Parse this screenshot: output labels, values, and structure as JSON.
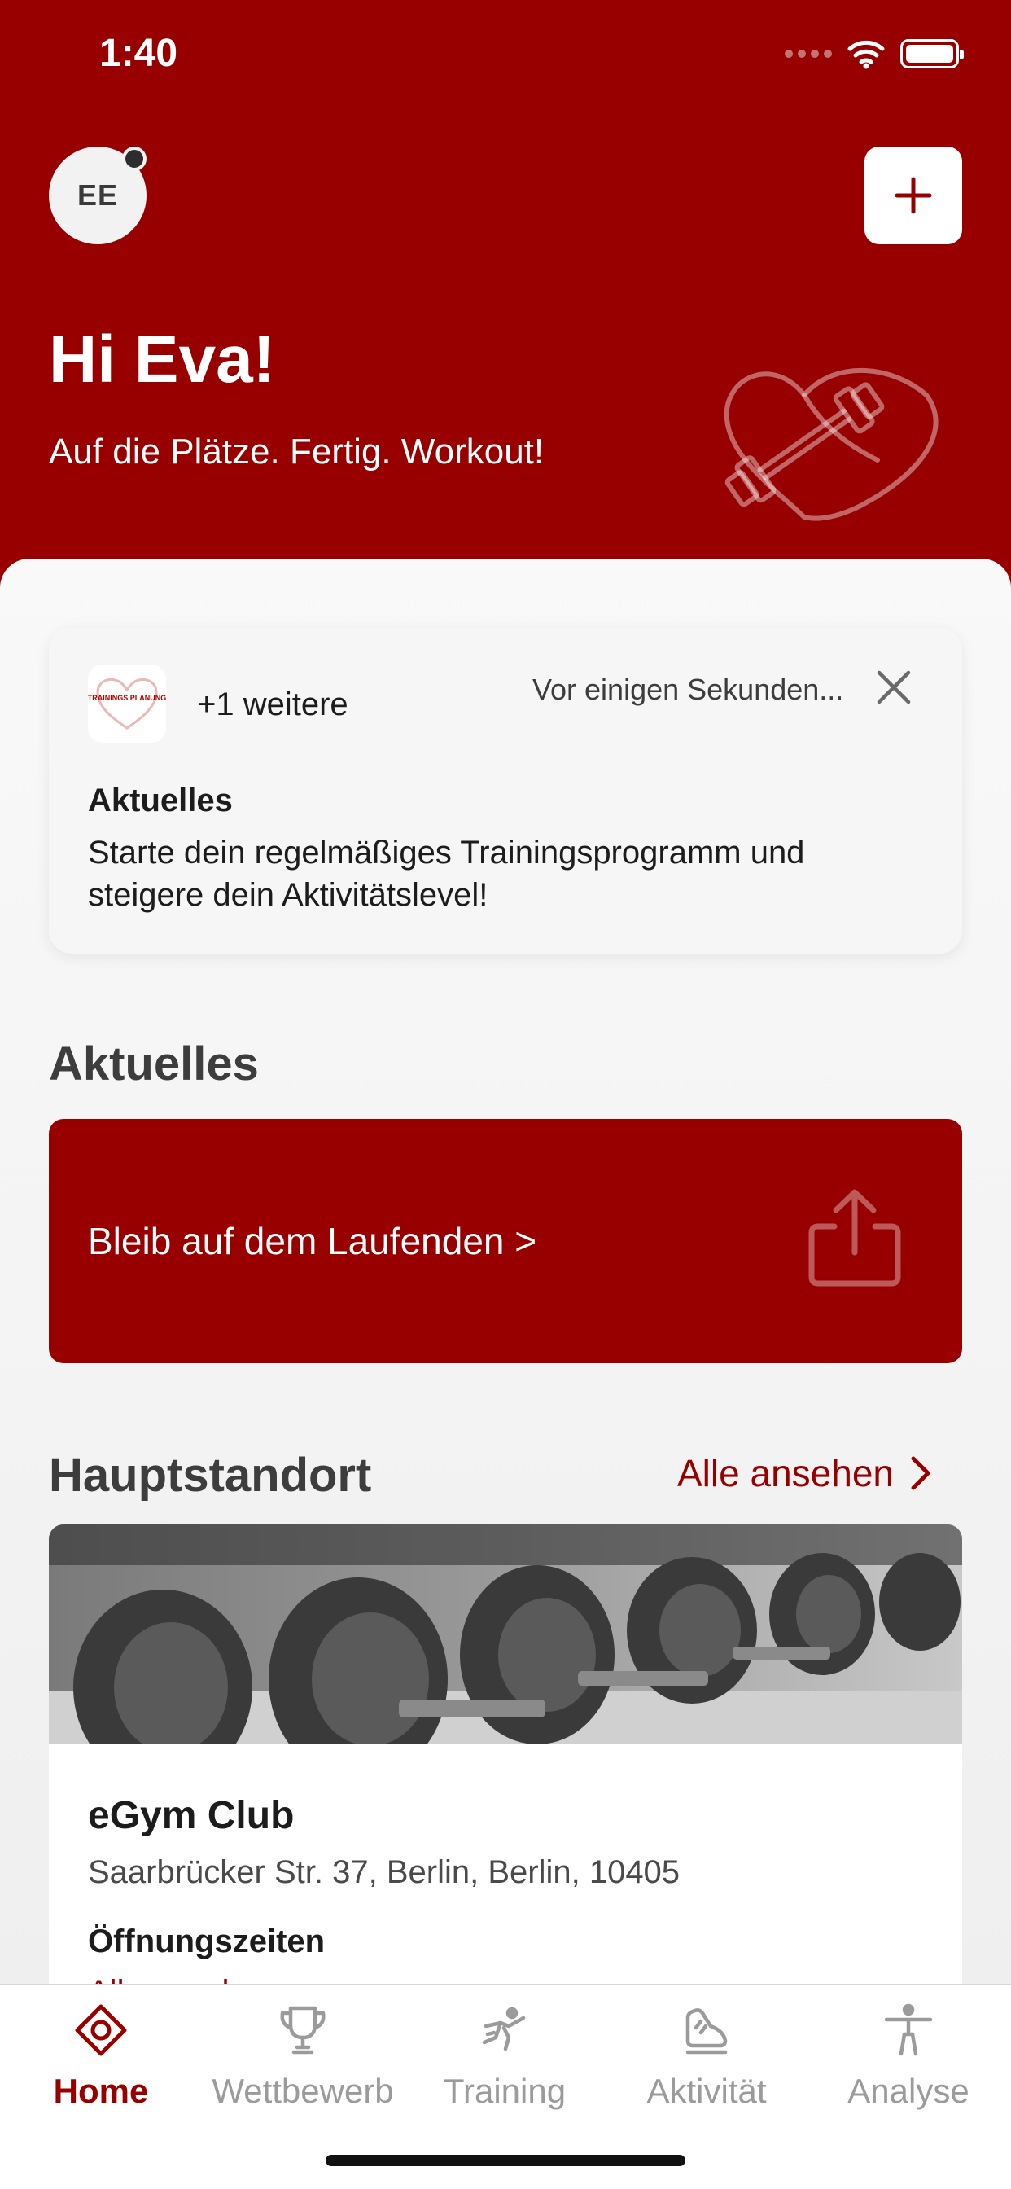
{
  "status_bar": {
    "time": "1:40"
  },
  "header": {
    "avatar_initials": "EE",
    "greeting": "Hi Eva!",
    "tagline": "Auf die Plätze. Fertig. Workout!"
  },
  "notification": {
    "thumb_text": "TRAININGS PLANUNG",
    "more_label": "+1 weitere",
    "time": "Vor einigen Sekunden...",
    "title": "Aktuelles",
    "body": "Starte dein regelmäßiges Trainingsprogramm und steigere dein Aktivitätslevel!"
  },
  "news": {
    "section_title": "Aktuelles",
    "banner_label": "Bleib auf dem Laufenden >"
  },
  "location": {
    "section_title": "Hauptstandort",
    "see_all_label": "Alle ansehen",
    "club_name": "eGym Club",
    "address": "Saarbrücker Str. 37, Berlin, Berlin, 10405",
    "hours_label": "Öffnungszeiten",
    "hours_link": "Alle ansehen"
  },
  "tabbar": {
    "tabs": [
      {
        "label": "Home",
        "icon": "home-icon",
        "active": true
      },
      {
        "label": "Wettbewerb",
        "icon": "trophy-icon",
        "active": false
      },
      {
        "label": "Training",
        "icon": "training-icon",
        "active": false
      },
      {
        "label": "Aktivität",
        "icon": "activity-icon",
        "active": false
      },
      {
        "label": "Analyse",
        "icon": "person-icon",
        "active": false
      }
    ]
  },
  "colors": {
    "brand": "#980000",
    "inactive": "#9b9b9b"
  }
}
